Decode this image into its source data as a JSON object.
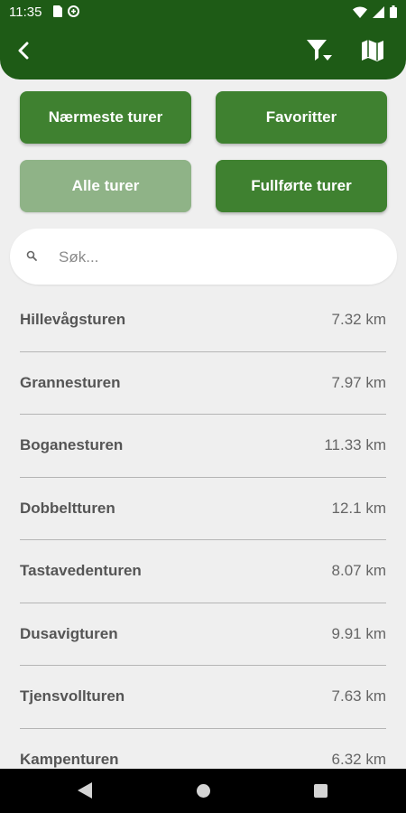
{
  "status_bar": {
    "time": "11:35"
  },
  "app_bar": {
    "back_icon": "chevron-left-icon",
    "filter_icon": "filter-icon",
    "map_icon": "map-icon"
  },
  "tabs": {
    "nearest": "Nærmeste turer",
    "favorites": "Favoritter",
    "all": "Alle turer",
    "completed": "Fullførte turer",
    "active_color": "#3f8130",
    "inactive_color": "#8fb387"
  },
  "search": {
    "placeholder": "Søk..."
  },
  "routes": [
    {
      "name": "Hillevågsturen",
      "distance": "7.32 km"
    },
    {
      "name": "Grannesturen",
      "distance": "7.97 km"
    },
    {
      "name": "Boganesturen",
      "distance": "11.33 km"
    },
    {
      "name": "Dobbeltturen",
      "distance": "12.1 km"
    },
    {
      "name": "Tastavedenturen",
      "distance": "8.07 km"
    },
    {
      "name": "Dusavigturen",
      "distance": "9.91 km"
    },
    {
      "name": "Tjensvollturen",
      "distance": "7.63 km"
    },
    {
      "name": "Kampenturen",
      "distance": "6.32 km"
    }
  ],
  "theme": {
    "primary": "#1e5b16"
  }
}
